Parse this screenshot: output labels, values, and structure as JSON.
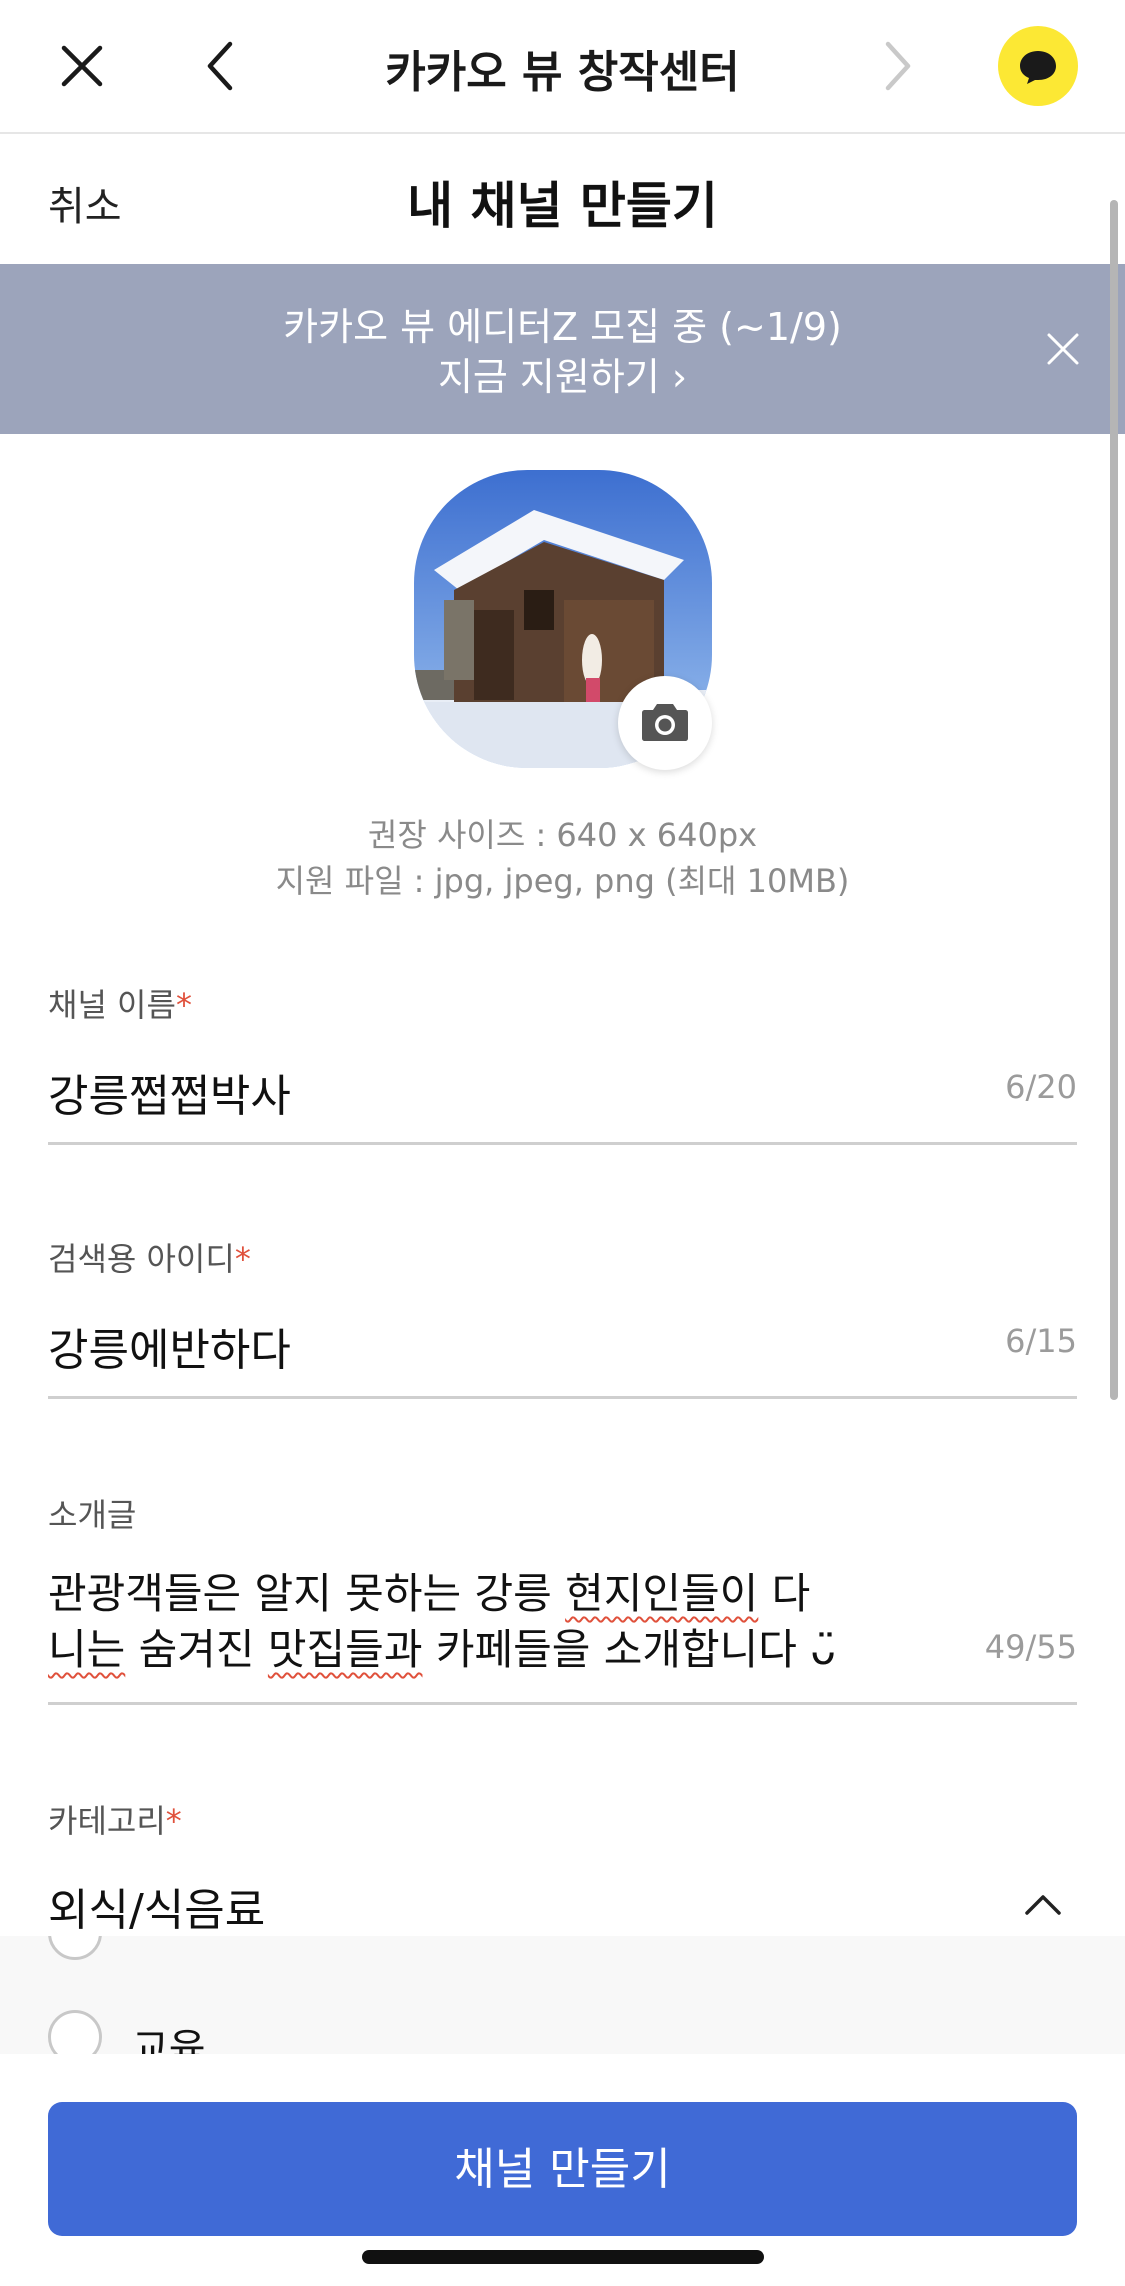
{
  "browser": {
    "title": "카카오 뷰 창작센터",
    "icons": [
      "close-icon",
      "back-icon",
      "forward-icon",
      "chat-bubble-icon"
    ]
  },
  "header": {
    "cancel_label": "취소",
    "title": "내 채널 만들기"
  },
  "banner": {
    "line1": "카카오 뷰 에디터Z 모집 중 (~1/9)",
    "line2": "지금 지원하기 ›"
  },
  "profile": {
    "size_hint": "권장 사이즈 : 640 x 640px",
    "file_hint": "지원 파일 : jpg, jpeg, png (최대 10MB)"
  },
  "fields": {
    "channel_name": {
      "label": "채널 이름",
      "required": "*",
      "value": "강릉쩝쩝박사",
      "count": "6/20"
    },
    "search_id": {
      "label": "검색용 아이디",
      "required": "*",
      "value": "강릉에반하다",
      "count": "6/15"
    },
    "intro": {
      "label": "소개글",
      "line1_a": "관광객들은 알지 못하는 강릉 ",
      "line1_b": "현지인들이",
      "line1_c": " 다",
      "line2_a": "니는",
      "line2_b": " 숨겨진 ",
      "line2_c": "맛집들과",
      "line2_d": " 카페들을 소개합니다 ",
      "emoji": "ᴗ̈",
      "count": "49/55"
    },
    "category": {
      "label": "카테고리",
      "required": "*",
      "value": "외식/식음료"
    }
  },
  "category_options": [
    {
      "label": "교육",
      "selected": false
    }
  ],
  "cta_label": "채널 만들기",
  "colors": {
    "banner": "#9ca4bb",
    "cta": "#406ad6",
    "required": "#e0513c",
    "kakao_yellow": "#fce834"
  }
}
